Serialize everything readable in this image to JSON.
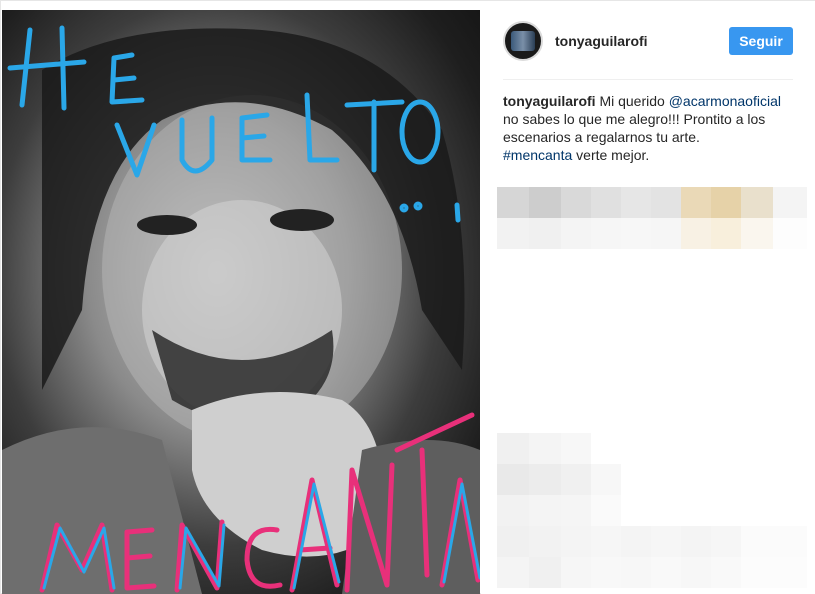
{
  "post": {
    "author": "tonyaguilarofi",
    "follow_label": "Seguir",
    "caption": {
      "username": "tonyaguilarofi",
      "text_before_mention": " Mi querido ",
      "mention": "@acarmonaoficial",
      "text_after_mention": " no sabes lo que me alegro!!! Prontito a los escenarios a regalarnos tu arte.",
      "hashtag": "#mencanta",
      "text_after_hashtag": " verte mejor."
    },
    "image": {
      "overlay_text_top": "HE VUELTO",
      "overlay_text_bottom": "MENCANTA"
    }
  },
  "colors": {
    "accent_blue": "#3897f0",
    "link": "#003569",
    "scrawl_blue": "#2aa7e8",
    "scrawl_pink": "#e8307a"
  },
  "icons": {
    "avatar": "profile-avatar"
  }
}
